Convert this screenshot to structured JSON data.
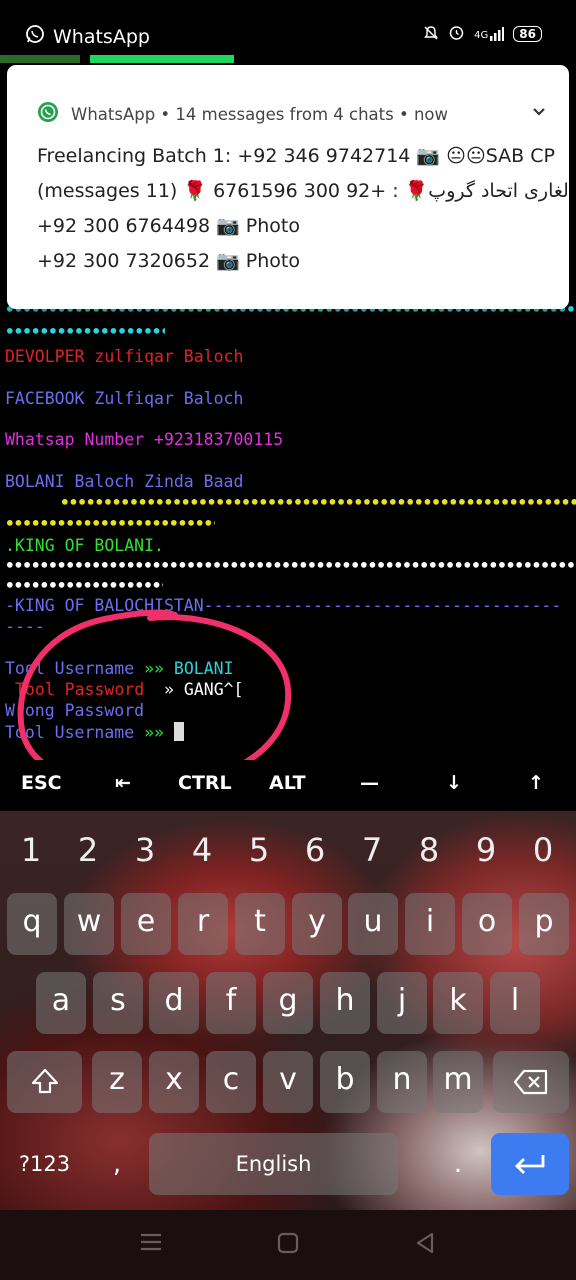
{
  "status_bar": {
    "app_name": "WhatsApp",
    "network": "4G",
    "battery": "86"
  },
  "notification": {
    "header": "WhatsApp • 14 messages from 4 chats • now",
    "messages": [
      "Freelancing Batch 1: +92 346 9742714 📷 😐😐SAB CP",
      "(messages 11) 🌹 لغاری اتحاد گروپ🌹 : +92 300 6761596 ...",
      "+92 300 6764498 📷 Photo",
      "+92 300 7320652 📷 Photo"
    ]
  },
  "terminal": {
    "developer": "DEVOLPER zulfiqar Baloch",
    "facebook": "FACEBOOK Zulfiqar Baloch",
    "whatsapp": "Whatsap Number +923183700115",
    "motto": "BOLANI Baloch Zinda Baad",
    "king_bolani": ".KING OF BOLANI.",
    "king_balochistan": "-KING OF BALOCHISTAN------------------------------------",
    "king_balochistan_cont": "----",
    "username_label": "Tool Username",
    "prompt_arrow": "»»",
    "username_value": "BOLANI",
    "password_label": "Tool Password",
    "password_arrow": "»",
    "password_value": "GANG^[",
    "wrong_password": "Wrong Password",
    "username_label2": "Tool Username"
  },
  "extra_keys": [
    "ESC",
    "⇤",
    "CTRL",
    "ALT",
    "—",
    "↓",
    "↑"
  ],
  "keyboard": {
    "numbers": [
      "1",
      "2",
      "3",
      "4",
      "5",
      "6",
      "7",
      "8",
      "9",
      "0"
    ],
    "row1": [
      "q",
      "w",
      "e",
      "r",
      "t",
      "y",
      "u",
      "i",
      "o",
      "p"
    ],
    "row2": [
      "a",
      "s",
      "d",
      "f",
      "g",
      "h",
      "j",
      "k",
      "l"
    ],
    "row3": [
      "z",
      "x",
      "c",
      "v",
      "b",
      "n",
      "m"
    ],
    "symbols_label": "?123",
    "comma": ",",
    "space_label": "English",
    "period": "."
  },
  "colors": {
    "cyan": "#29d3d8",
    "red": "#e02424",
    "blue": "#6a6ef0",
    "magenta": "#e030e0",
    "yellow": "#e8e020",
    "green": "#30e030",
    "white": "#ffffff",
    "enter": "#3d7bf0",
    "annotation": "#f0306a"
  },
  "icons": [
    "whatsapp-icon",
    "mute-icon",
    "alarm-icon",
    "signal-icon",
    "battery-icon",
    "chevron-down-icon",
    "shift-icon",
    "backspace-icon",
    "enter-icon",
    "nav-menu-icon",
    "nav-home-icon",
    "nav-back-icon"
  ]
}
